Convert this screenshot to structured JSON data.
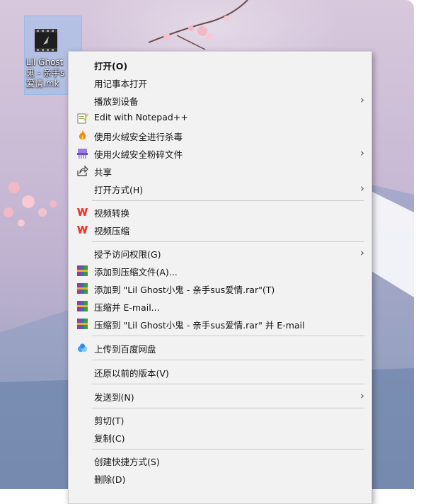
{
  "desktop": {
    "icon_label_lines": [
      "Lil Ghost",
      "鬼 - 亲手s",
      "爱情.mk"
    ]
  },
  "menu": {
    "open": "打开(O)",
    "open_notepad": "用记事本打开",
    "cast": "播放到设备",
    "notepadpp": "Edit with Notepad++",
    "huorong_scan": "使用火绒安全进行杀毒",
    "huorong_shred": "使用火绒安全粉碎文件",
    "share": "共享",
    "open_with": "打开方式(H)",
    "wps_convert": "视频转换",
    "wps_compress": "视频压缩",
    "grant_access": "授予访问权限(G)",
    "add_archive": "添加到压缩文件(A)...",
    "add_rar": "添加到 \"Lil Ghost小鬼 - 亲手sus爱情.rar\"(T)",
    "compress_email": "压缩并 E-mail...",
    "compress_rar_email": "压缩到 \"Lil Ghost小鬼 - 亲手sus爱情.rar\" 并 E-mail",
    "baidu_upload": "上传到百度网盘",
    "restore": "还原以前的版本(V)",
    "send_to": "发送到(N)",
    "cut": "剪切(T)",
    "copy": "复制(C)",
    "create_shortcut": "创建快捷方式(S)",
    "delete": "删除(D)"
  },
  "icons": {
    "notepadpp": "notepad-plus-plus-icon",
    "huorong": "huorong-flame-icon",
    "shredder": "shredder-icon",
    "share": "share-icon",
    "wps": "wps-logo-icon",
    "winrar": "winrar-icon",
    "baidu": "baidu-netdisk-icon"
  }
}
